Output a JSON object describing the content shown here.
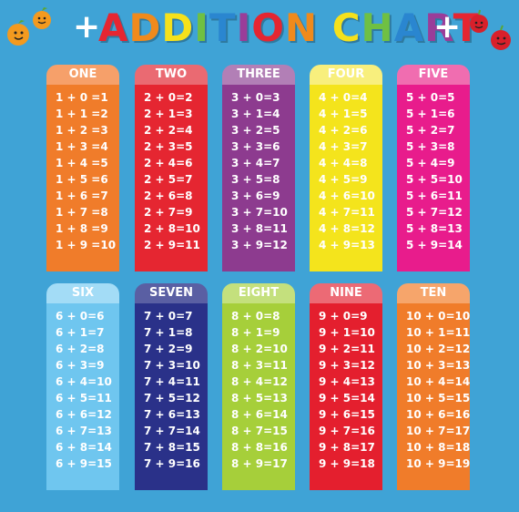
{
  "title": {
    "letters": [
      "A",
      "D",
      "D",
      "I",
      "T",
      "I",
      "O",
      "N",
      " ",
      "C",
      "H",
      "A",
      "R",
      "T"
    ],
    "letter_colors": [
      "#e52631",
      "#f08a1c",
      "#f5e11c",
      "#6fc043",
      "#2a86d0",
      "#9a3d99",
      "#e52631",
      "#f08a1c",
      "#ffffff",
      "#f5e11c",
      "#6fc043",
      "#2a86d0",
      "#9a3d99",
      "#e52631"
    ],
    "plus_left": "+",
    "plus_right": "+"
  },
  "cards": [
    {
      "label": "ONE",
      "head_color": "#f6a06a",
      "body_color": "#f07c2a",
      "equations": [
        "1 + 0 =1",
        "1 + 1 =2",
        "1 + 2 =3",
        "1 + 3 =4",
        "1 + 4 =5",
        "1 + 5 =6",
        "1 + 6 =7",
        "1 + 7 =8",
        "1 + 8 =9",
        "1 + 9 =10"
      ]
    },
    {
      "label": "TWO",
      "head_color": "#ea6a72",
      "body_color": "#e52631",
      "equations": [
        "2 + 0=2",
        "2 + 1=3",
        "2 + 2=4",
        "2 + 3=5",
        "2 + 4=6",
        "2 + 5=7",
        "2 + 6=8",
        "2 + 7=9",
        "2 + 8=10",
        "2 + 9=11"
      ]
    },
    {
      "label": "THREE",
      "head_color": "#b27fb6",
      "body_color": "#8d3b8f",
      "equations": [
        "3 + 0=3",
        "3 + 1=4",
        "3 + 2=5",
        "3 + 3=6",
        "3 + 4=7",
        "3 + 5=8",
        "3 + 6=9",
        "3 + 7=10",
        "3 + 8=11",
        "3 + 9=12"
      ]
    },
    {
      "label": "FOUR",
      "head_color": "#f8ef7d",
      "body_color": "#f4e41c",
      "equations": [
        "4 + 0=4",
        "4 + 1=5",
        "4 + 2=6",
        "4 + 3=7",
        "4 + 4=8",
        "4 + 5=9",
        "4 + 6=10",
        "4 + 7=11",
        "4 + 8=12",
        "4 + 9=13"
      ]
    },
    {
      "label": "FIVE",
      "head_color": "#f06db0",
      "body_color": "#e81c8c",
      "equations": [
        "5 + 0=5",
        "5 + 1=6",
        "5 + 2=7",
        "5 + 3=8",
        "5 + 4=9",
        "5 + 5=10",
        "5 + 6=11",
        "5 + 7=12",
        "5 + 8=13",
        "5 + 9=14"
      ]
    },
    {
      "label": "SIX",
      "head_color": "#a3dcf6",
      "body_color": "#6fc6ef",
      "equations": [
        "6 + 0=6",
        "6 + 1=7",
        "6 + 2=8",
        "6 + 3=9",
        "6 + 4=10",
        "6 + 5=11",
        "6 + 6=12",
        "6 + 7=13",
        "6 + 8=14",
        "6 + 9=15"
      ]
    },
    {
      "label": "SEVEN",
      "head_color": "#5a5fa3",
      "body_color": "#2a3189",
      "equations": [
        "7 + 0=7",
        "7 + 1=8",
        "7 + 2=9",
        "7 + 3=10",
        "7 + 4=11",
        "7 + 5=12",
        "7 + 6=13",
        "7 + 7=14",
        "7 + 8=15",
        "7 + 9=16"
      ]
    },
    {
      "label": "EIGHT",
      "head_color": "#c4e07d",
      "body_color": "#a6cf3a",
      "equations": [
        "8 + 0=8",
        "8 + 1=9",
        "8 + 2=10",
        "8 + 3=11",
        "8 + 4=12",
        "8 + 5=13",
        "8 + 6=14",
        "8 + 7=15",
        "8 + 8=16",
        "8 + 9=17"
      ]
    },
    {
      "label": "NINE",
      "head_color": "#ec6a75",
      "body_color": "#e41f2e",
      "equations": [
        "9 + 0=9",
        "9 + 1=10",
        "9 + 2=11",
        "9 + 3=12",
        "9 + 4=13",
        "9 + 5=14",
        "9 + 6=15",
        "9 + 7=16",
        "9 + 8=17",
        "9 + 9=18"
      ]
    },
    {
      "label": "TEN",
      "head_color": "#f6a56b",
      "body_color": "#f07c2a",
      "equations": [
        "10 + 0=10",
        "10 + 1=11",
        "10 + 2=12",
        "10 + 3=13",
        "10 + 4=14",
        "10 + 5=15",
        "10 + 6=16",
        "10 + 7=17",
        "10 + 8=18",
        "10 + 9=19"
      ]
    }
  ],
  "decorations": {
    "left_mascot": "orange-fruit-icon",
    "right_mascot": "apple-fruit-icon"
  }
}
